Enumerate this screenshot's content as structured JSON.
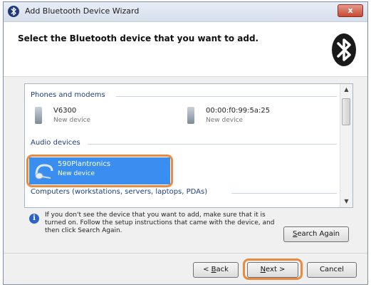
{
  "window": {
    "title": "Add Bluetooth Device Wizard",
    "close_label": "x",
    "accent_color": "#3a8ef0",
    "highlight_color": "#e98a3e"
  },
  "header": {
    "heading": "Select the Bluetooth device that you want to add.",
    "icon": "bluetooth-icon"
  },
  "device_list": {
    "groups": [
      {
        "label": "Phones and modems",
        "devices": [
          {
            "name": "V6300",
            "status": "New device",
            "icon": "phone-icon"
          },
          {
            "name": "00:00:f0:99:5a:25",
            "status": "New device",
            "icon": "phone-icon"
          }
        ]
      },
      {
        "label": "Audio devices",
        "devices": [
          {
            "name": "590Plantronics",
            "status": "New device",
            "icon": "headset-icon",
            "selected": true
          }
        ]
      },
      {
        "label": "Computers (workstations, servers, laptops, PDAs)",
        "devices": []
      }
    ]
  },
  "info": {
    "text": "If you don't see the device that you want to add, make sure that it is turned on. Follow the setup instructions that came with the device, and then click Search Again."
  },
  "buttons": {
    "search_again": {
      "label": "Search Again",
      "access_key": "S",
      "rest": "earch Again"
    },
    "back": {
      "label": "< Back",
      "prefix": "< ",
      "access_key": "B",
      "rest": "ack"
    },
    "next": {
      "label": "Next >",
      "prefix": "",
      "access_key": "N",
      "rest": "ext >"
    },
    "cancel": {
      "label": "Cancel"
    }
  }
}
